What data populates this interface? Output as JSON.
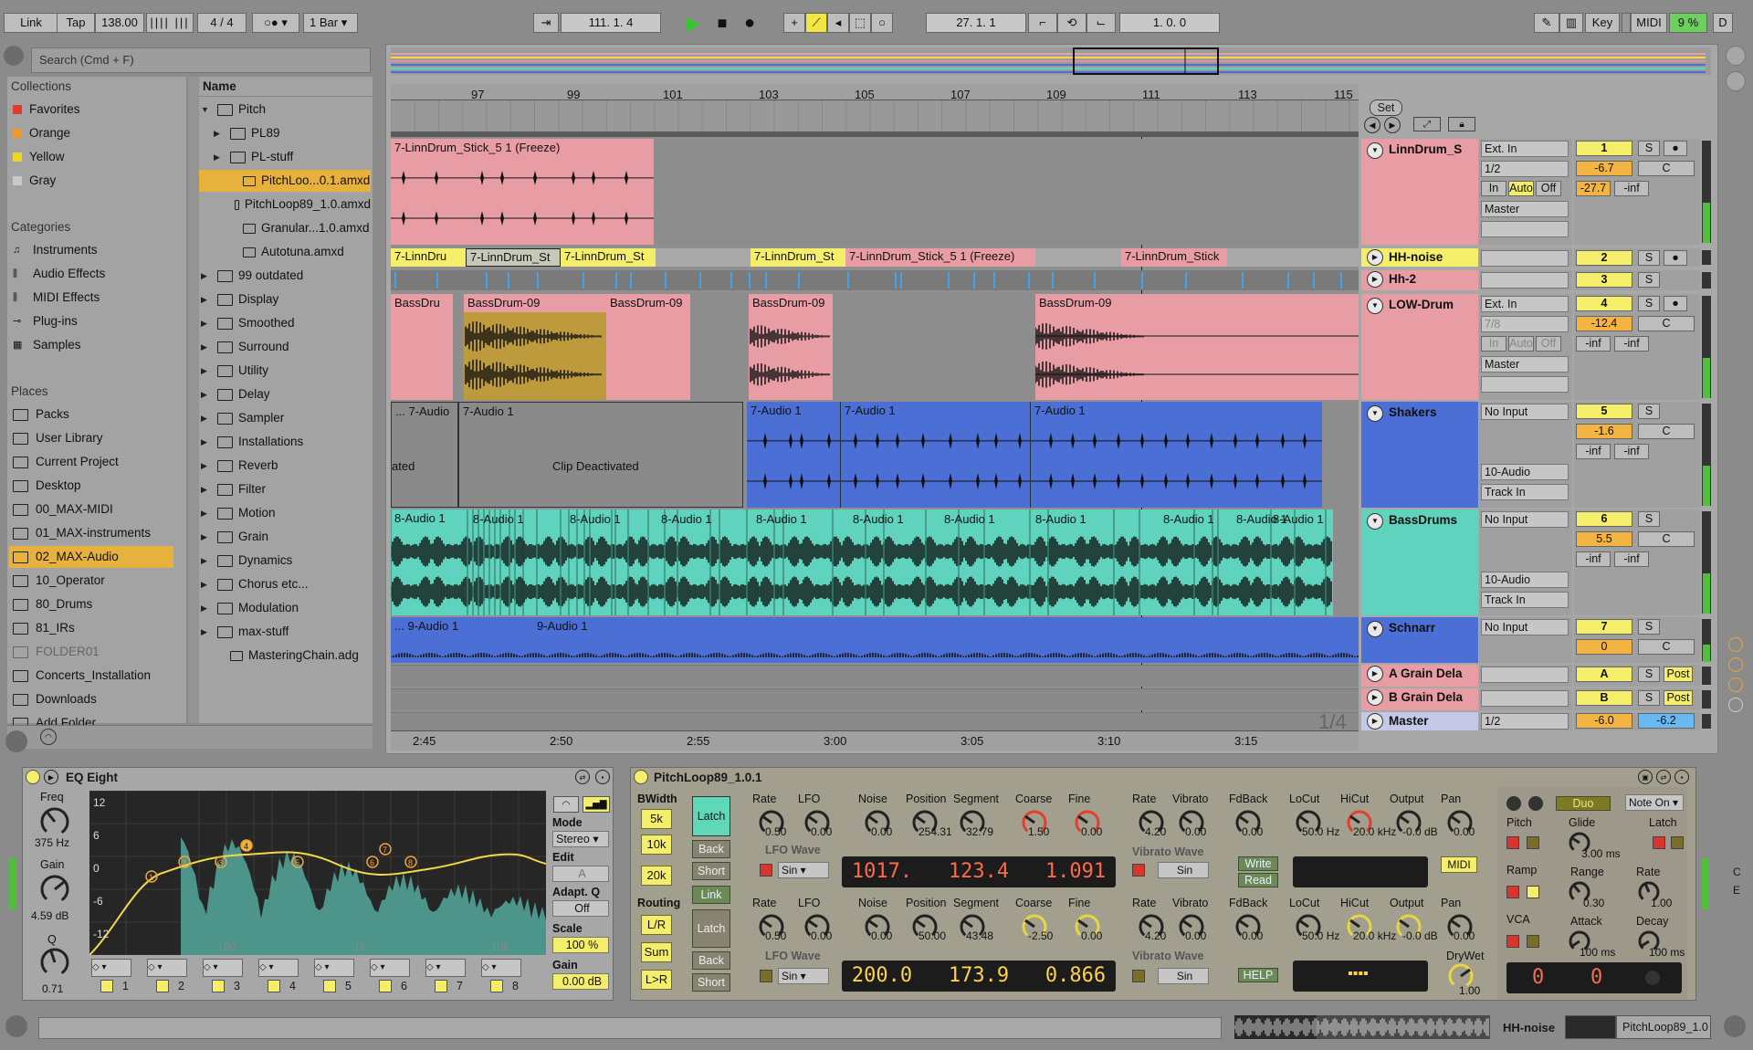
{
  "transport": {
    "link": "Link",
    "tap": "Tap",
    "tempo": "138.00",
    "meter": "4 / 4",
    "quantize": "1 Bar",
    "position": "111.   1.   4",
    "loop_start": "27.   1.   1",
    "loop_length": "1.   0.   0",
    "key": "Key",
    "midi": "MIDI",
    "cpu": "9 %",
    "d": "D"
  },
  "browser": {
    "search_placeholder": "Search (Cmd + F)",
    "collections_title": "Collections",
    "collections": [
      {
        "label": "Favorites",
        "color": "#e33a2e"
      },
      {
        "label": "Orange",
        "color": "#f09a2b"
      },
      {
        "label": "Yellow",
        "color": "#f2d51f"
      },
      {
        "label": "Gray",
        "color": "#c9c9c9"
      }
    ],
    "categories_title": "Categories",
    "categories": [
      "Instruments",
      "Audio Effects",
      "MIDI Effects",
      "Plug-ins",
      "Samples"
    ],
    "places_title": "Places",
    "places": [
      "Packs",
      "User Library",
      "Current Project",
      "Desktop",
      "00_MAX-MIDI",
      "01_MAX-instruments",
      "02_MAX-Audio",
      "10_Operator",
      "80_Drums",
      "81_IRs",
      "FOLDER01",
      "Concerts_Installation",
      "Downloads",
      "Add Folder..."
    ],
    "name_header": "Name",
    "items": [
      "Pitch",
      "PL89",
      "PL-stuff",
      "PitchLoo...0.1.amxd",
      "PitchLoop89_1.0.amxd",
      "Granular...1.0.amxd",
      "Autotuna.amxd",
      "99 outdated",
      "Display",
      "Smoothed",
      "Surround",
      "Utility",
      "Delay",
      "Sampler",
      "Installations",
      "Reverb",
      "Filter",
      "Motion",
      "Grain",
      "Dynamics",
      "Chorus etc...",
      "Modulation",
      "max-stuff",
      "MasteringChain.adg"
    ]
  },
  "arrangement": {
    "ruler": [
      "97",
      "99",
      "101",
      "103",
      "105",
      "107",
      "109",
      "111",
      "113",
      "115"
    ],
    "timeline": [
      "2:45",
      "2:50",
      "2:55",
      "3:00",
      "3:05",
      "3:10",
      "3:15"
    ],
    "set_label": "Set",
    "zoom_label": "1/4",
    "clips": {
      "linn_freeze": "7-LinnDrum_Stick_5 1 (Freeze)",
      "hh_a": "7-LinnDru",
      "hh_b": "7-LinnDrum_St",
      "hh_c": "7-LinnDrum_St",
      "hh_d": "7-LinnDrum_St",
      "hh_e": "7-LinnDrum_Stick_5 1 (Freeze)",
      "hh_f": "7-LinnDrum_Stick",
      "bass_a": "BassDru",
      "bass_b": "BassDrum-09",
      "bass_c": "BassDrum-09",
      "bass_d": "BassDrum-09",
      "bass_e": "BassDrum-09",
      "sh_a": "... 7-Audio",
      "sh_b": "7-Audio 1",
      "sh_deact": "Clip Deactivated",
      "sh_ated": "ated",
      "sh_c": "7-Audio 1",
      "sh_d": "7-Audio 1",
      "sh_e": "7-Audio 1",
      "bd_a": "8-Audio 1",
      "bd_b": "8-Audio 1",
      "sch_a": "... 9-Audio 1",
      "sch_b": "9-Audio 1"
    }
  },
  "tracks": [
    {
      "name": "LinnDrum_S",
      "in": "Ext. In",
      "ch": "1/2",
      "mon": [
        "In",
        "Auto",
        "Off"
      ],
      "out": "Master",
      "num": "1",
      "vol": "-6.7",
      "pan": "C",
      "peak1": "-27.7",
      "peak2": "-inf"
    },
    {
      "name": "HH-noise",
      "num": "2"
    },
    {
      "name": "Hh-2",
      "num": "3"
    },
    {
      "name": "LOW-Drum",
      "in": "Ext. In",
      "ch": "7/8",
      "mon": [
        "In",
        "Auto",
        "Off"
      ],
      "out": "Master",
      "num": "4",
      "vol": "-12.4",
      "pan": "C",
      "peak1": "-inf",
      "peak2": "-inf"
    },
    {
      "name": "Shakers",
      "in": "No Input",
      "out": "10-Audio",
      "out2": "Track In",
      "num": "5",
      "vol": "-1.6",
      "pan": "C",
      "peak1": "-inf",
      "peak2": "-inf"
    },
    {
      "name": "BassDrums",
      "in": "No Input",
      "out": "10-Audio",
      "out2": "Track In",
      "num": "6",
      "vol": "5.5",
      "pan": "C",
      "peak1": "-inf",
      "peak2": "-inf"
    },
    {
      "name": "Schnarr",
      "in": "No Input",
      "num": "7",
      "vol": "0",
      "pan": "C"
    },
    {
      "name": "A Grain Dela",
      "num": "A",
      "post": "Post"
    },
    {
      "name": "B Grain Dela",
      "num": "B",
      "post": "Post"
    },
    {
      "name": "Master",
      "ch": "1/2",
      "vol": "-6.0",
      "pan": "-6.2"
    }
  ],
  "mixer_common": {
    "solo": "S"
  },
  "eq": {
    "title": "EQ Eight",
    "freq_label": "Freq",
    "freq_value": "375 Hz",
    "gain_label": "Gain",
    "gain_value": "4.59 dB",
    "q_label": "Q",
    "q_value": "0.71",
    "db_scale": [
      "12",
      "6",
      "0",
      "-6",
      "-12"
    ],
    "freq_scale": [
      "100",
      "1k",
      "10k"
    ],
    "mode_label": "Mode",
    "mode_value": "Stereo",
    "edit_label": "Edit",
    "edit_value": "A",
    "adapt_label": "Adapt. Q",
    "adapt_value": "Off",
    "scale_label": "Scale",
    "scale_value": "100 %",
    "gain2_label": "Gain",
    "gain2_value": "0.00 dB",
    "bands": [
      "1",
      "2",
      "3",
      "4",
      "5",
      "6",
      "7",
      "8"
    ]
  },
  "pitchloop": {
    "title": "PitchLoop89_1.0.1",
    "bwidth": "BWidth",
    "bw_opts": [
      "5k",
      "10k",
      "20k"
    ],
    "routing": "Routing",
    "route_opts": [
      "L/R",
      "Sum",
      "L>R"
    ],
    "latch": "Latch",
    "back": "Back",
    "short": "Short",
    "link": "Link",
    "row1": {
      "rate": "0.50",
      "lfo": "0.00",
      "noise": "0.00",
      "position": "254.31",
      "segment": "32.79",
      "coarse": "1.50",
      "fine": "0.00",
      "rate2": "4.20",
      "vibrato": "0.00",
      "fdback": "0.00",
      "locut": "50.0 Hz",
      "hicut": "20.0 kHz",
      "output": "-0.0 dB",
      "pan": "0.00"
    },
    "row2": {
      "rate": "0.50",
      "lfo": "0.00",
      "noise": "0.00",
      "position": "50.00",
      "segment": "43.48",
      "coarse": "-2.50",
      "fine": "0.00",
      "rate2": "4.20",
      "vibrato": "0.00",
      "fdback": "0.00",
      "locut": "50.0 Hz",
      "hicut": "20.0 kHz",
      "output": "-0.0 dB",
      "pan": "0.00"
    },
    "labels": {
      "rate": "Rate",
      "lfo": "LFO",
      "noise": "Noise",
      "position": "Position",
      "segment": "Segment",
      "coarse": "Coarse",
      "fine": "Fine",
      "vibrato": "Vibrato",
      "fdback": "FdBack",
      "locut": "LoCut",
      "hicut": "HiCut",
      "output": "Output",
      "pan": "Pan",
      "drywet": "DryWet"
    },
    "lfo_wave": "LFO Wave",
    "sin": "Sin",
    "vib_wave": "Vibrato Wave",
    "disp1": [
      "1017.",
      "123.4",
      "1.091"
    ],
    "disp2": [
      "200.0",
      "173.9",
      "0.866"
    ],
    "write": "Write",
    "read": "Read",
    "help": "HELP",
    "midi": "MIDI",
    "drywet_value": "1.00",
    "duo": "Duo",
    "noteon": "Note On",
    "pitch": "Pitch",
    "glide": "Glide",
    "glide_value": "3.00 ms",
    "latch2": "Latch",
    "ramp": "Ramp",
    "range": "Range",
    "range_value": "0.30",
    "rate3": "Rate",
    "rate3_value": "1.00",
    "vca": "VCA",
    "attack": "Attack",
    "attack_value": "100 ms",
    "decay": "Decay",
    "decay_value": "100 ms",
    "counter": [
      "0",
      "0"
    ]
  },
  "status": {
    "track": "HH-noise",
    "device": "PitchLoop89_1.0"
  }
}
